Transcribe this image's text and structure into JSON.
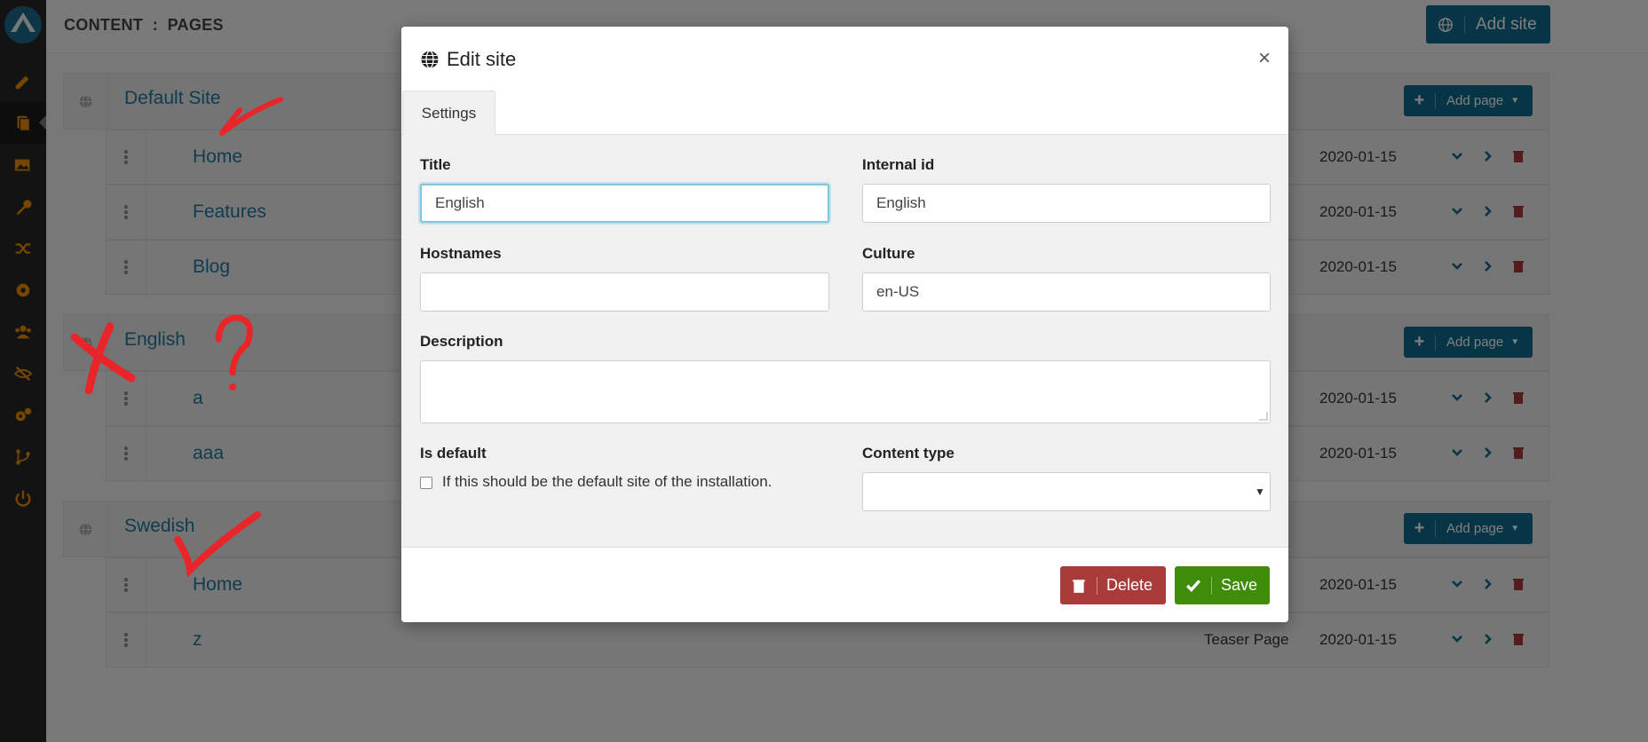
{
  "breadcrumb": "CONTENT  :  PAGES",
  "add_site_label": "Add site",
  "sites": [
    {
      "name": "Default Site",
      "add_page_label": "Add page",
      "pages": [
        {
          "title": "Home",
          "type": "",
          "date": "2020-01-15"
        },
        {
          "title": "Features",
          "type": "",
          "date": "2020-01-15"
        },
        {
          "title": "Blog",
          "type": "",
          "date": "2020-01-15"
        }
      ]
    },
    {
      "name": "English",
      "add_page_label": "Add page",
      "pages": [
        {
          "title": "a",
          "type": "",
          "date": "2020-01-15"
        },
        {
          "title": "aaa",
          "type": "",
          "date": "2020-01-15"
        }
      ]
    },
    {
      "name": "Swedish",
      "add_page_label": "Add page",
      "pages": [
        {
          "title": "Home",
          "type": "",
          "date": "2020-01-15"
        },
        {
          "title": "z",
          "type": "Teaser Page",
          "date": "2020-01-15"
        }
      ]
    }
  ],
  "modal": {
    "title": "Edit site",
    "close_glyph": "×",
    "tab_settings": "Settings",
    "title_label": "Title",
    "title_value": "English",
    "internal_id_label": "Internal id",
    "internal_id_value": "English",
    "hostnames_label": "Hostnames",
    "hostnames_value": "",
    "culture_label": "Culture",
    "culture_value": "en-US",
    "description_label": "Description",
    "is_default_label": "Is default",
    "is_default_checkbox_text": "If this should be the default site of the installation.",
    "is_default_checked": false,
    "content_type_label": "Content type",
    "content_type_value": "",
    "delete_label": "Delete",
    "save_label": "Save"
  },
  "annotations": {
    "question_mark": "?"
  },
  "colors": {
    "accent": "#0e6a8c",
    "sidebar_icon": "#e88c00",
    "delete": "#a93b3b",
    "save": "#3e8c0a",
    "link": "#1f78a0",
    "annotation": "#e8262a"
  },
  "sidebar_icons": [
    "pencil-icon",
    "pages-icon",
    "media-icon",
    "wrench-icon",
    "shuffle-icon",
    "settings-icon",
    "users-icon",
    "eye-slash-icon",
    "gears-icon",
    "branch-icon",
    "power-icon"
  ]
}
